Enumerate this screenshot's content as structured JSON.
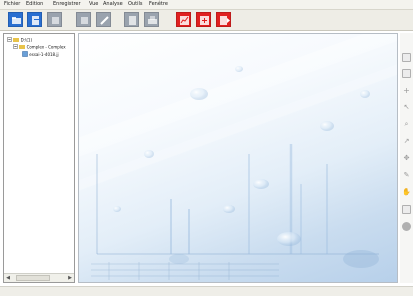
{
  "menu": {
    "items": [
      "Fichier",
      "Edition",
      "Enregistrer",
      "Vue",
      "Analyse",
      "Outils",
      "Fenêtre"
    ]
  },
  "toolbar": {
    "buttons": [
      {
        "name": "new-folder-icon",
        "color": "#2a6fd1"
      },
      {
        "name": "open-icon",
        "color": "#2a6fd1"
      },
      {
        "name": "save-icon",
        "color": "#9aa3ae"
      },
      {
        "name": "edit-icon",
        "color": "#9aa3ae"
      },
      {
        "name": "pencil-icon",
        "color": "#9aa3ae"
      },
      {
        "name": "document-icon",
        "color": "#9aa3ae"
      },
      {
        "name": "print-icon",
        "color": "#9aa3ae"
      },
      {
        "name": "chart-red-icon",
        "color": "#e02020"
      },
      {
        "name": "chart-add-icon",
        "color": "#e02020"
      },
      {
        "name": "chart-export-icon",
        "color": "#e02020"
      }
    ]
  },
  "tree": {
    "items": [
      {
        "label": "D:\\(1)"
      },
      {
        "label": "Complex - Complex"
      },
      {
        "label": "essai-1-4018.jj"
      }
    ]
  },
  "colors": {
    "accent": "#2a6fd1",
    "danger": "#e02020",
    "canvas_fade": "#b7d0ea"
  }
}
